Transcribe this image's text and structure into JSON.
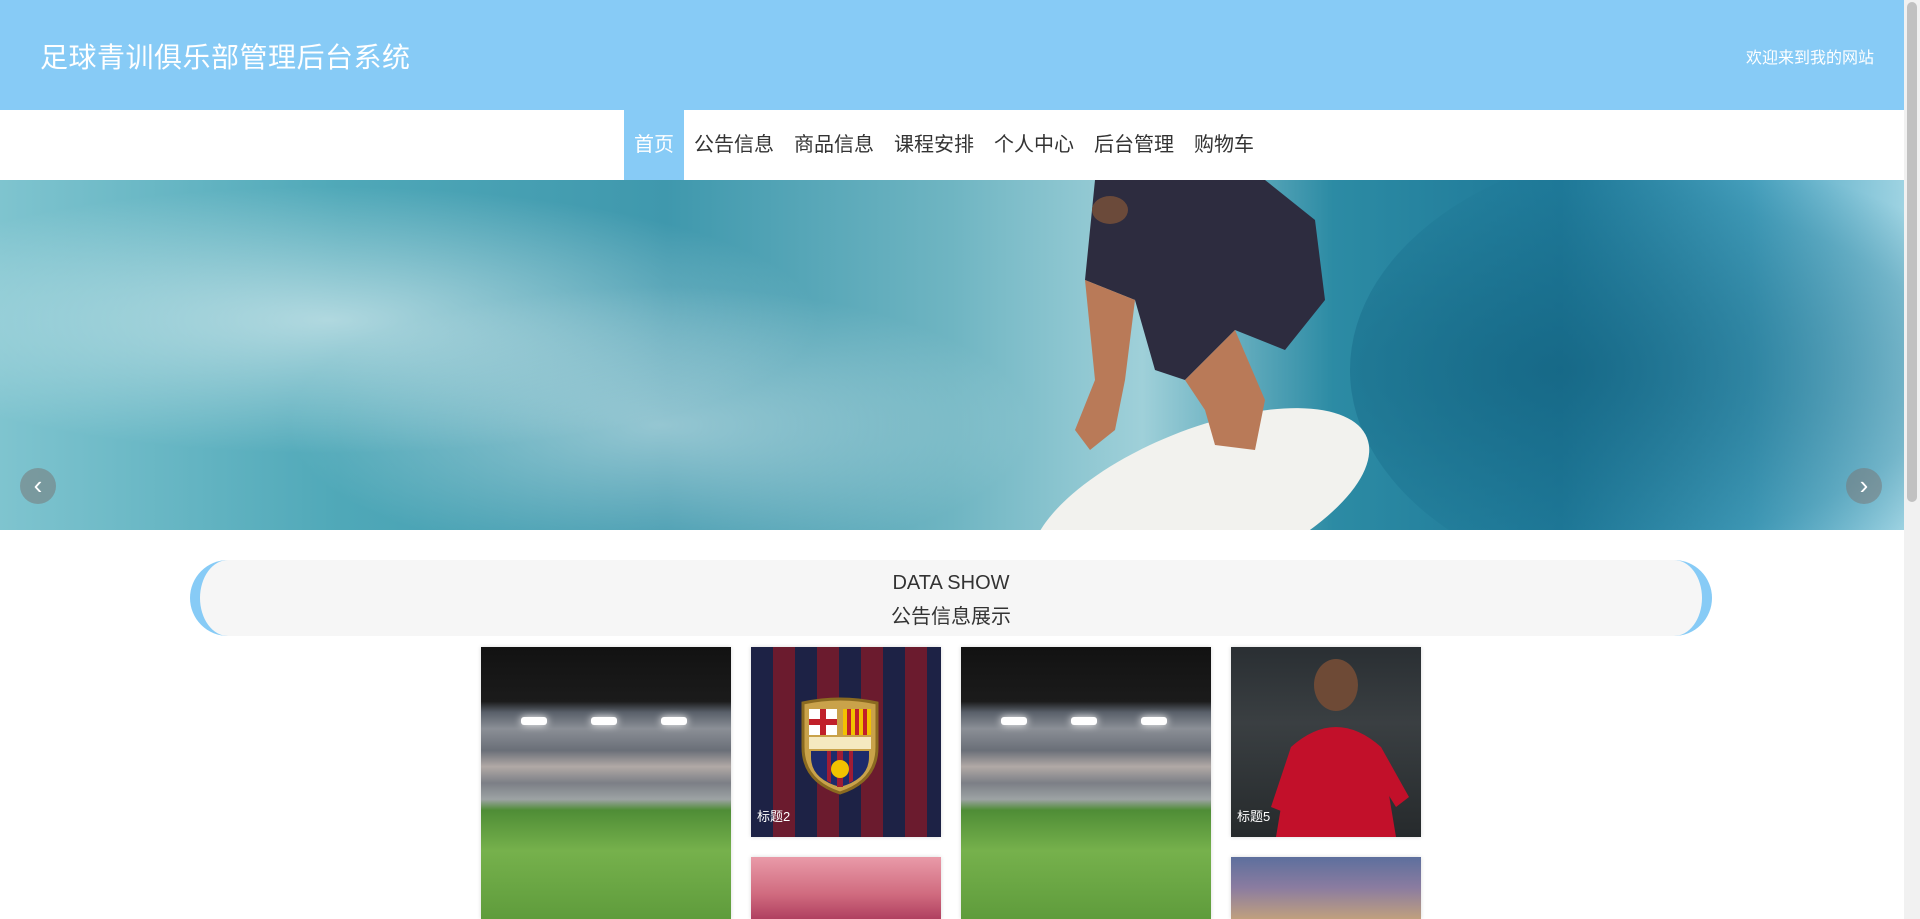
{
  "header": {
    "title": "足球青训俱乐部管理后台系统",
    "welcome": "欢迎来到我的网站"
  },
  "nav": {
    "items": [
      {
        "label": "首页",
        "active": true
      },
      {
        "label": "公告信息"
      },
      {
        "label": "商品信息"
      },
      {
        "label": "课程安排"
      },
      {
        "label": "个人中心"
      },
      {
        "label": "后台管理"
      },
      {
        "label": "购物车"
      }
    ]
  },
  "banner": {
    "prev_icon": "chevron-left-icon",
    "next_icon": "chevron-right-icon",
    "prev_glyph": "‹",
    "next_glyph": "›",
    "slide_count": 3,
    "active_slide": 1
  },
  "section": {
    "title_en": "DATA SHOW",
    "title_cn": "公告信息展示"
  },
  "gallery": {
    "items": [
      {
        "caption": ""
      },
      {
        "caption": "标题2"
      },
      {
        "caption": ""
      },
      {
        "caption": "标题5"
      },
      {
        "caption": ""
      },
      {
        "caption": ""
      }
    ]
  },
  "colors": {
    "accent": "#87cbf6",
    "text": "#333333"
  }
}
